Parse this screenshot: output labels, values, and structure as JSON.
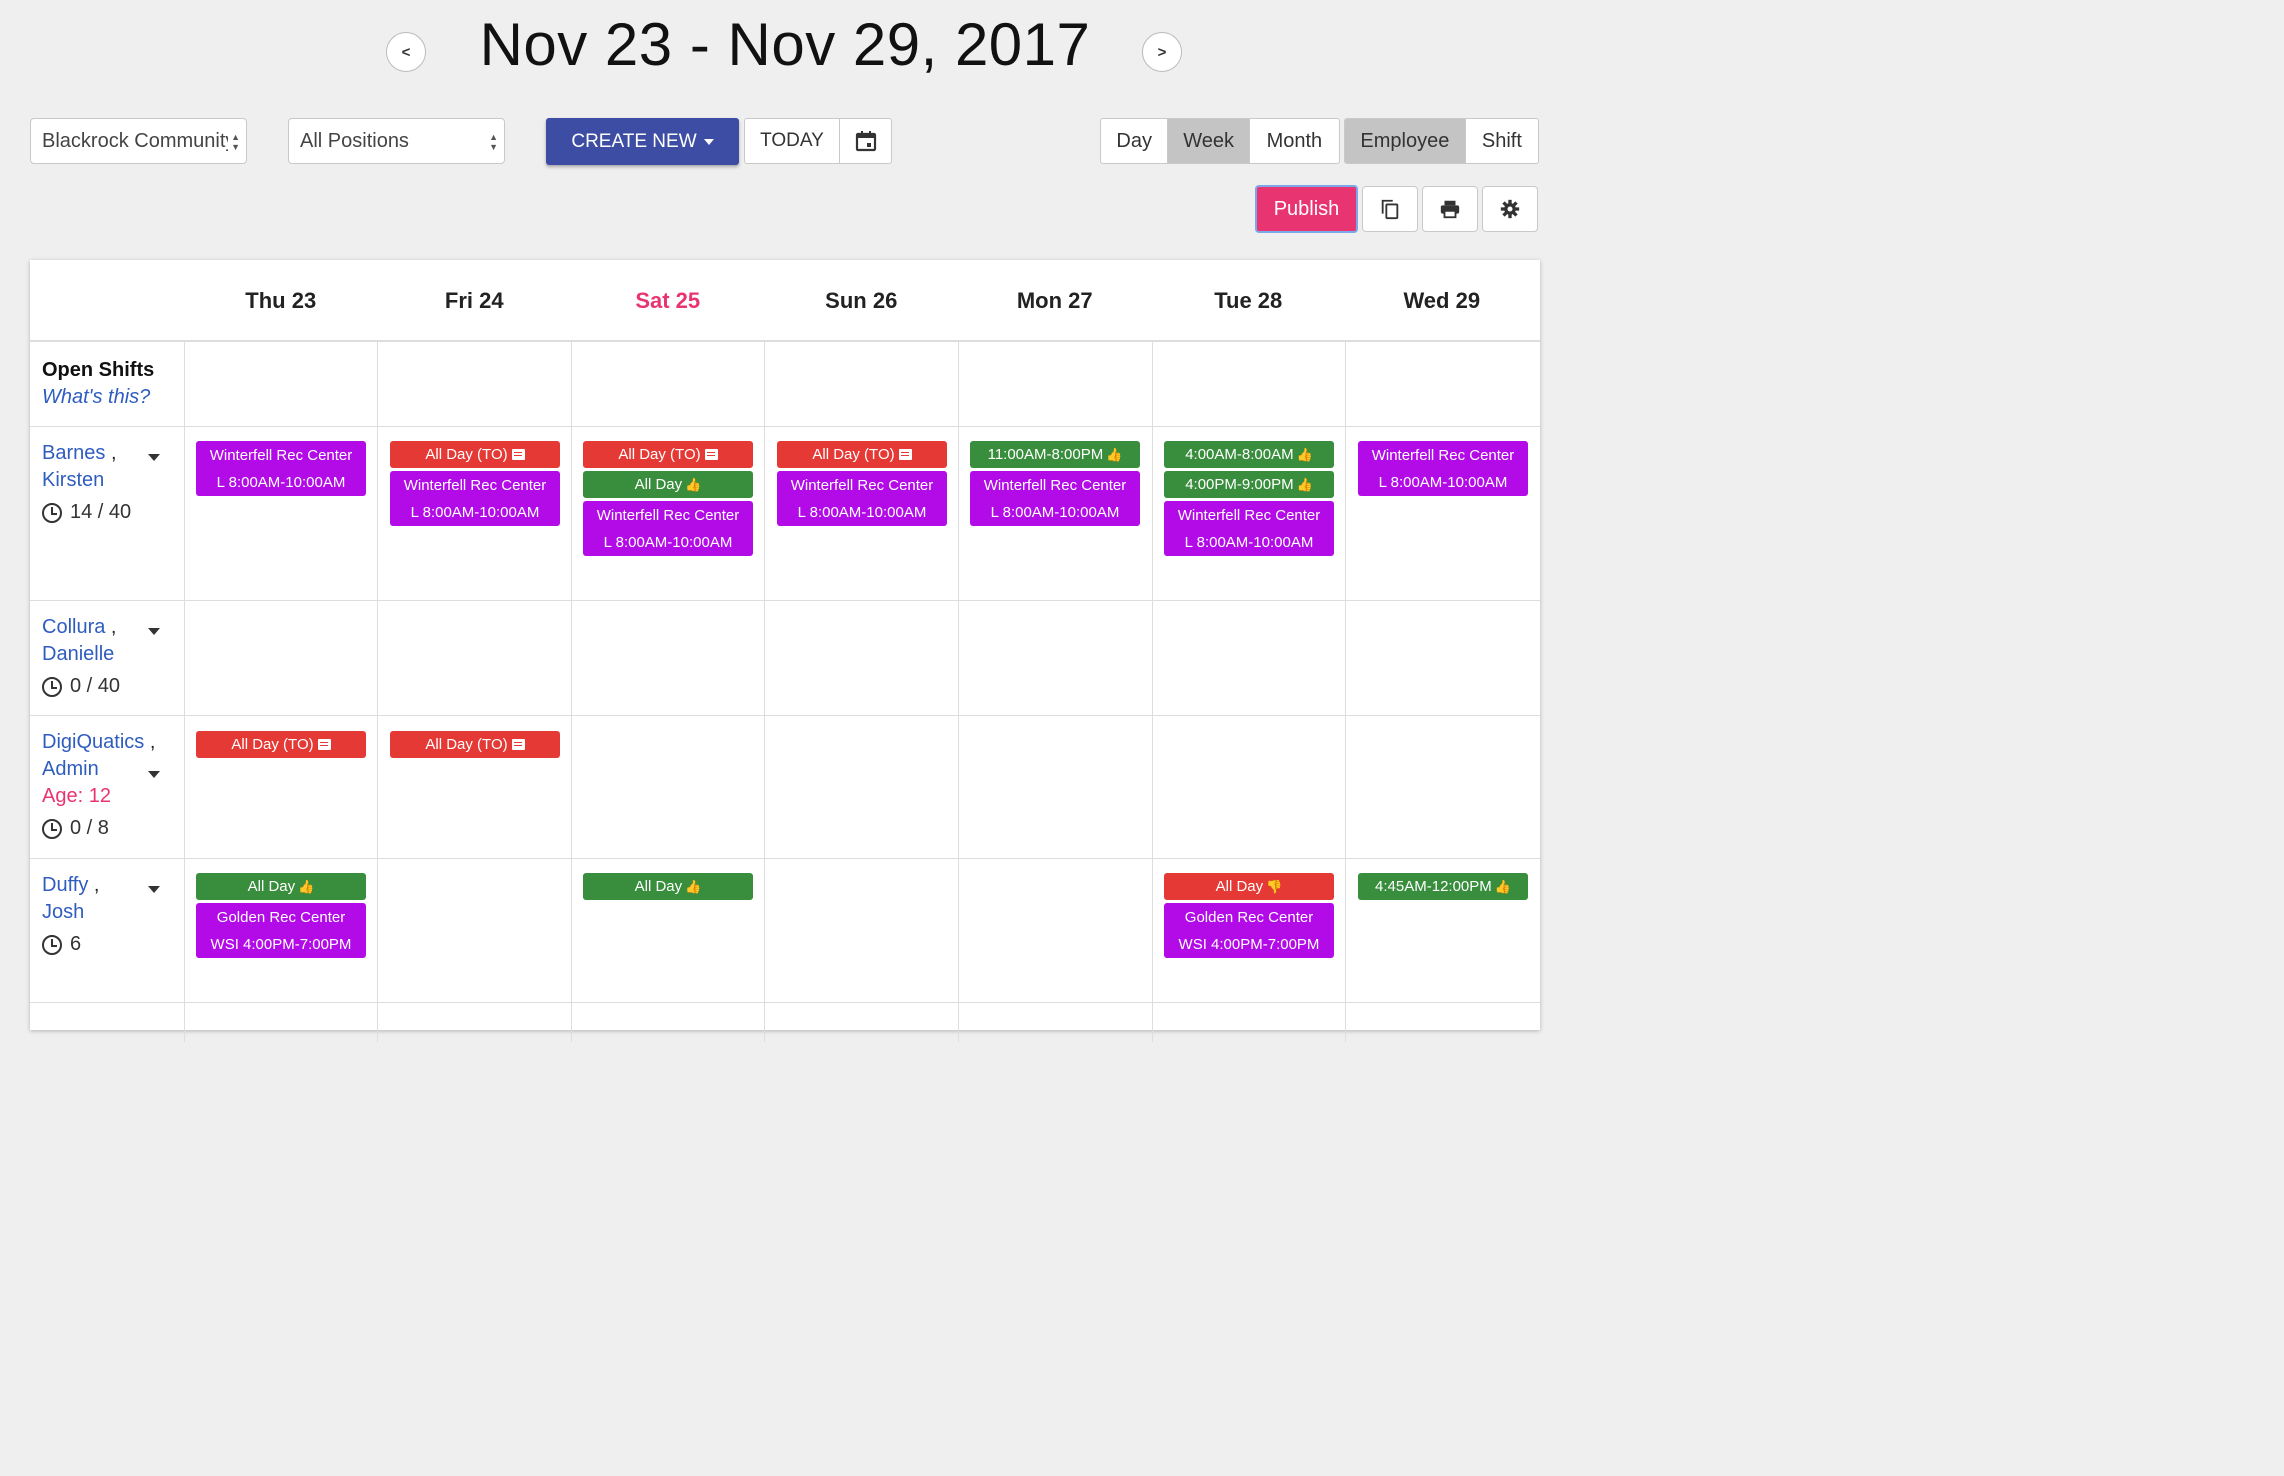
{
  "header": {
    "title": "Nov 23 - Nov 29, 2017",
    "prev": "<",
    "next": ">"
  },
  "toolbar": {
    "location_select": "Blackrock Community",
    "positions_select": "All Positions",
    "create_new": "CREATE NEW",
    "today": "TODAY",
    "views": [
      "Day",
      "Week",
      "Month"
    ],
    "active_view": "Week",
    "groupings": [
      "Employee",
      "Shift"
    ],
    "active_grouping": "Employee",
    "publish": "Publish"
  },
  "icons": {
    "calendar": "calendar-icon",
    "copy": "copy-icon",
    "print": "print-icon",
    "settings": "gear-icon",
    "clock": "clock-icon",
    "thumbs_up": "thumbs-up-icon",
    "thumbs_down": "thumbs-down-icon",
    "message": "message-icon"
  },
  "colors": {
    "primary": "#3d4da3",
    "publish": "#e83571",
    "time_off": "#e53935",
    "available": "#388e3c",
    "shift": "#b30be8",
    "link": "#2f5dbf",
    "weekend": "#e83571"
  },
  "days": [
    {
      "label": "Thu 23",
      "highlight": false
    },
    {
      "label": "Fri 24",
      "highlight": false
    },
    {
      "label": "Sat 25",
      "highlight": true
    },
    {
      "label": "Sun 26",
      "highlight": false
    },
    {
      "label": "Mon 27",
      "highlight": false
    },
    {
      "label": "Tue 28",
      "highlight": false
    },
    {
      "label": "Wed 29",
      "highlight": false
    }
  ],
  "open_shifts": {
    "title": "Open Shifts",
    "help": "What's this?"
  },
  "employees": [
    {
      "last": "Barnes",
      "first": "Kirsten",
      "hours": "14 / 40",
      "shifts": {
        "thu": [
          {
            "lines": [
              "Winterfell Rec Center",
              "L 8:00AM-10:00AM"
            ],
            "type": "shift"
          }
        ],
        "fri": [
          {
            "lines": [
              "All Day (TO)"
            ],
            "type": "timeoff",
            "icon": "message"
          },
          {
            "lines": [
              "Winterfell Rec Center",
              "L 8:00AM-10:00AM"
            ],
            "type": "shift"
          }
        ],
        "sat": [
          {
            "lines": [
              "All Day (TO)"
            ],
            "type": "timeoff",
            "icon": "message"
          },
          {
            "lines": [
              "All Day"
            ],
            "type": "available",
            "icon": "thumbs_up"
          },
          {
            "lines": [
              "Winterfell Rec Center",
              "L 8:00AM-10:00AM"
            ],
            "type": "shift"
          }
        ],
        "sun": [
          {
            "lines": [
              "All Day (TO)"
            ],
            "type": "timeoff",
            "icon": "message"
          },
          {
            "lines": [
              "Winterfell Rec Center",
              "L 8:00AM-10:00AM"
            ],
            "type": "shift"
          }
        ],
        "mon": [
          {
            "lines": [
              "11:00AM-8:00PM"
            ],
            "type": "available",
            "icon": "thumbs_up"
          },
          {
            "lines": [
              "Winterfell Rec Center",
              "L 8:00AM-10:00AM"
            ],
            "type": "shift"
          }
        ],
        "tue": [
          {
            "lines": [
              "4:00AM-8:00AM"
            ],
            "type": "available",
            "icon": "thumbs_up"
          },
          {
            "lines": [
              "4:00PM-9:00PM"
            ],
            "type": "available",
            "icon": "thumbs_up"
          },
          {
            "lines": [
              "Winterfell Rec Center",
              "L 8:00AM-10:00AM"
            ],
            "type": "shift"
          }
        ],
        "wed": [
          {
            "lines": [
              "Winterfell Rec Center",
              "L 8:00AM-10:00AM"
            ],
            "type": "shift"
          }
        ]
      }
    },
    {
      "last": "Collura",
      "first": "Danielle",
      "hours": "0 / 40"
    },
    {
      "last": "DigiQuatics",
      "first": "Admin",
      "age": "Age: 12",
      "hours": "0 / 8",
      "shifts": {
        "thu": [
          {
            "lines": [
              "All Day (TO)"
            ],
            "type": "timeoff",
            "icon": "message"
          }
        ],
        "fri": [
          {
            "lines": [
              "All Day (TO)"
            ],
            "type": "timeoff",
            "icon": "message"
          }
        ]
      }
    },
    {
      "last": "Duffy",
      "first": "Josh",
      "hours": "6",
      "shifts": {
        "thu": [
          {
            "lines": [
              "All Day"
            ],
            "type": "available",
            "icon": "thumbs_up"
          },
          {
            "lines": [
              "Golden Rec Center",
              "WSI 4:00PM-7:00PM"
            ],
            "type": "shift"
          }
        ],
        "sat": [
          {
            "lines": [
              "All Day"
            ],
            "type": "available",
            "icon": "thumbs_up"
          }
        ],
        "tue": [
          {
            "lines": [
              "All Day"
            ],
            "type": "timeoff",
            "icon": "thumbs_down"
          },
          {
            "lines": [
              "Golden Rec Center",
              "WSI 4:00PM-7:00PM"
            ],
            "type": "shift"
          }
        ],
        "wed": [
          {
            "lines": [
              "4:45AM-12:00PM"
            ],
            "type": "available",
            "icon": "thumbs_up"
          }
        ]
      }
    }
  ],
  "comma": ","
}
